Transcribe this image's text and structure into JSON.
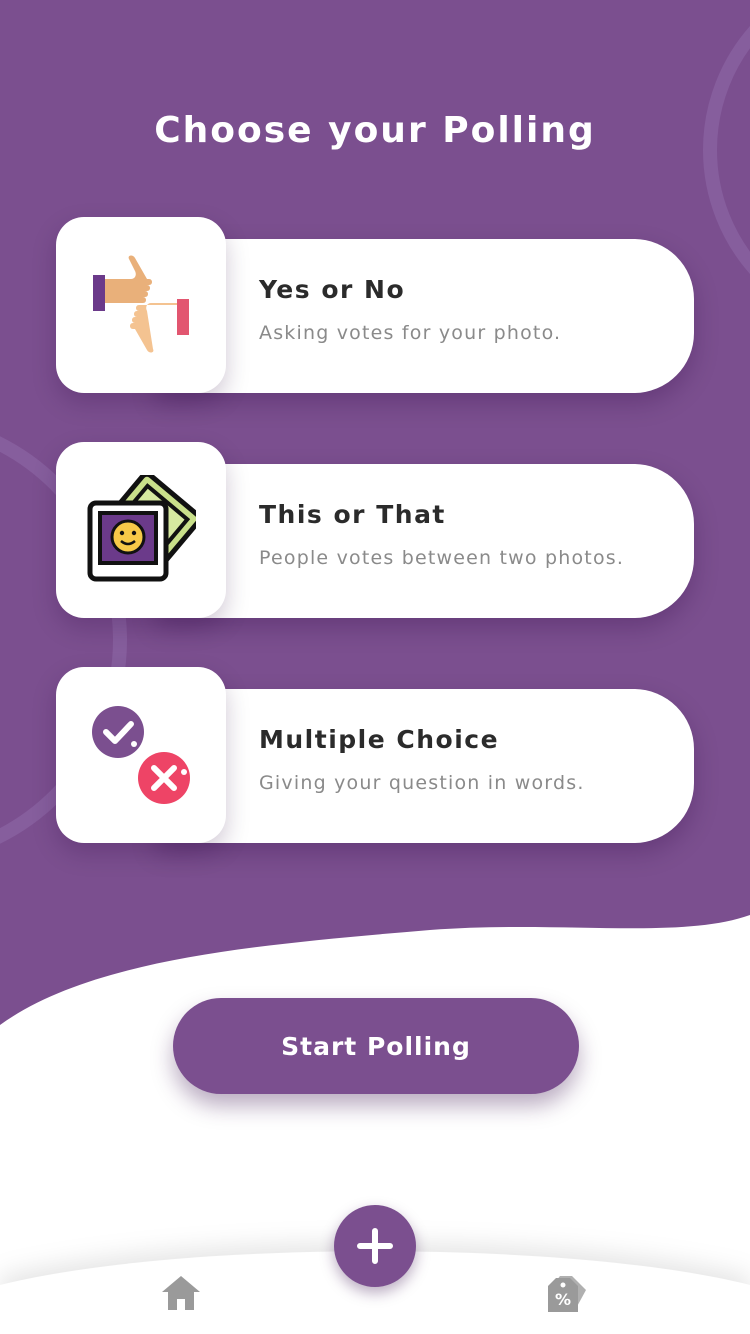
{
  "header": {
    "title": "Choose your Polling"
  },
  "colors": {
    "primary": "#7b4f8f",
    "card_bg": "#ffffff",
    "title_text": "#2b2b2b",
    "subtitle_text": "#8a8a8a"
  },
  "options": [
    {
      "title": "Yes or No",
      "subtitle": "Asking votes for your photo.",
      "icon": "thumbs-up-down-icon"
    },
    {
      "title": "This or That",
      "subtitle": "People votes between two photos.",
      "icon": "photos-icon"
    },
    {
      "title": "Multiple Choice",
      "subtitle": "Giving your question in words.",
      "icon": "check-cross-icon"
    }
  ],
  "actions": {
    "start_label": "Start Polling"
  },
  "bottom_nav": {
    "items": [
      {
        "icon": "home-icon"
      },
      {
        "icon": "add-icon"
      },
      {
        "icon": "discount-tag-icon"
      }
    ]
  }
}
